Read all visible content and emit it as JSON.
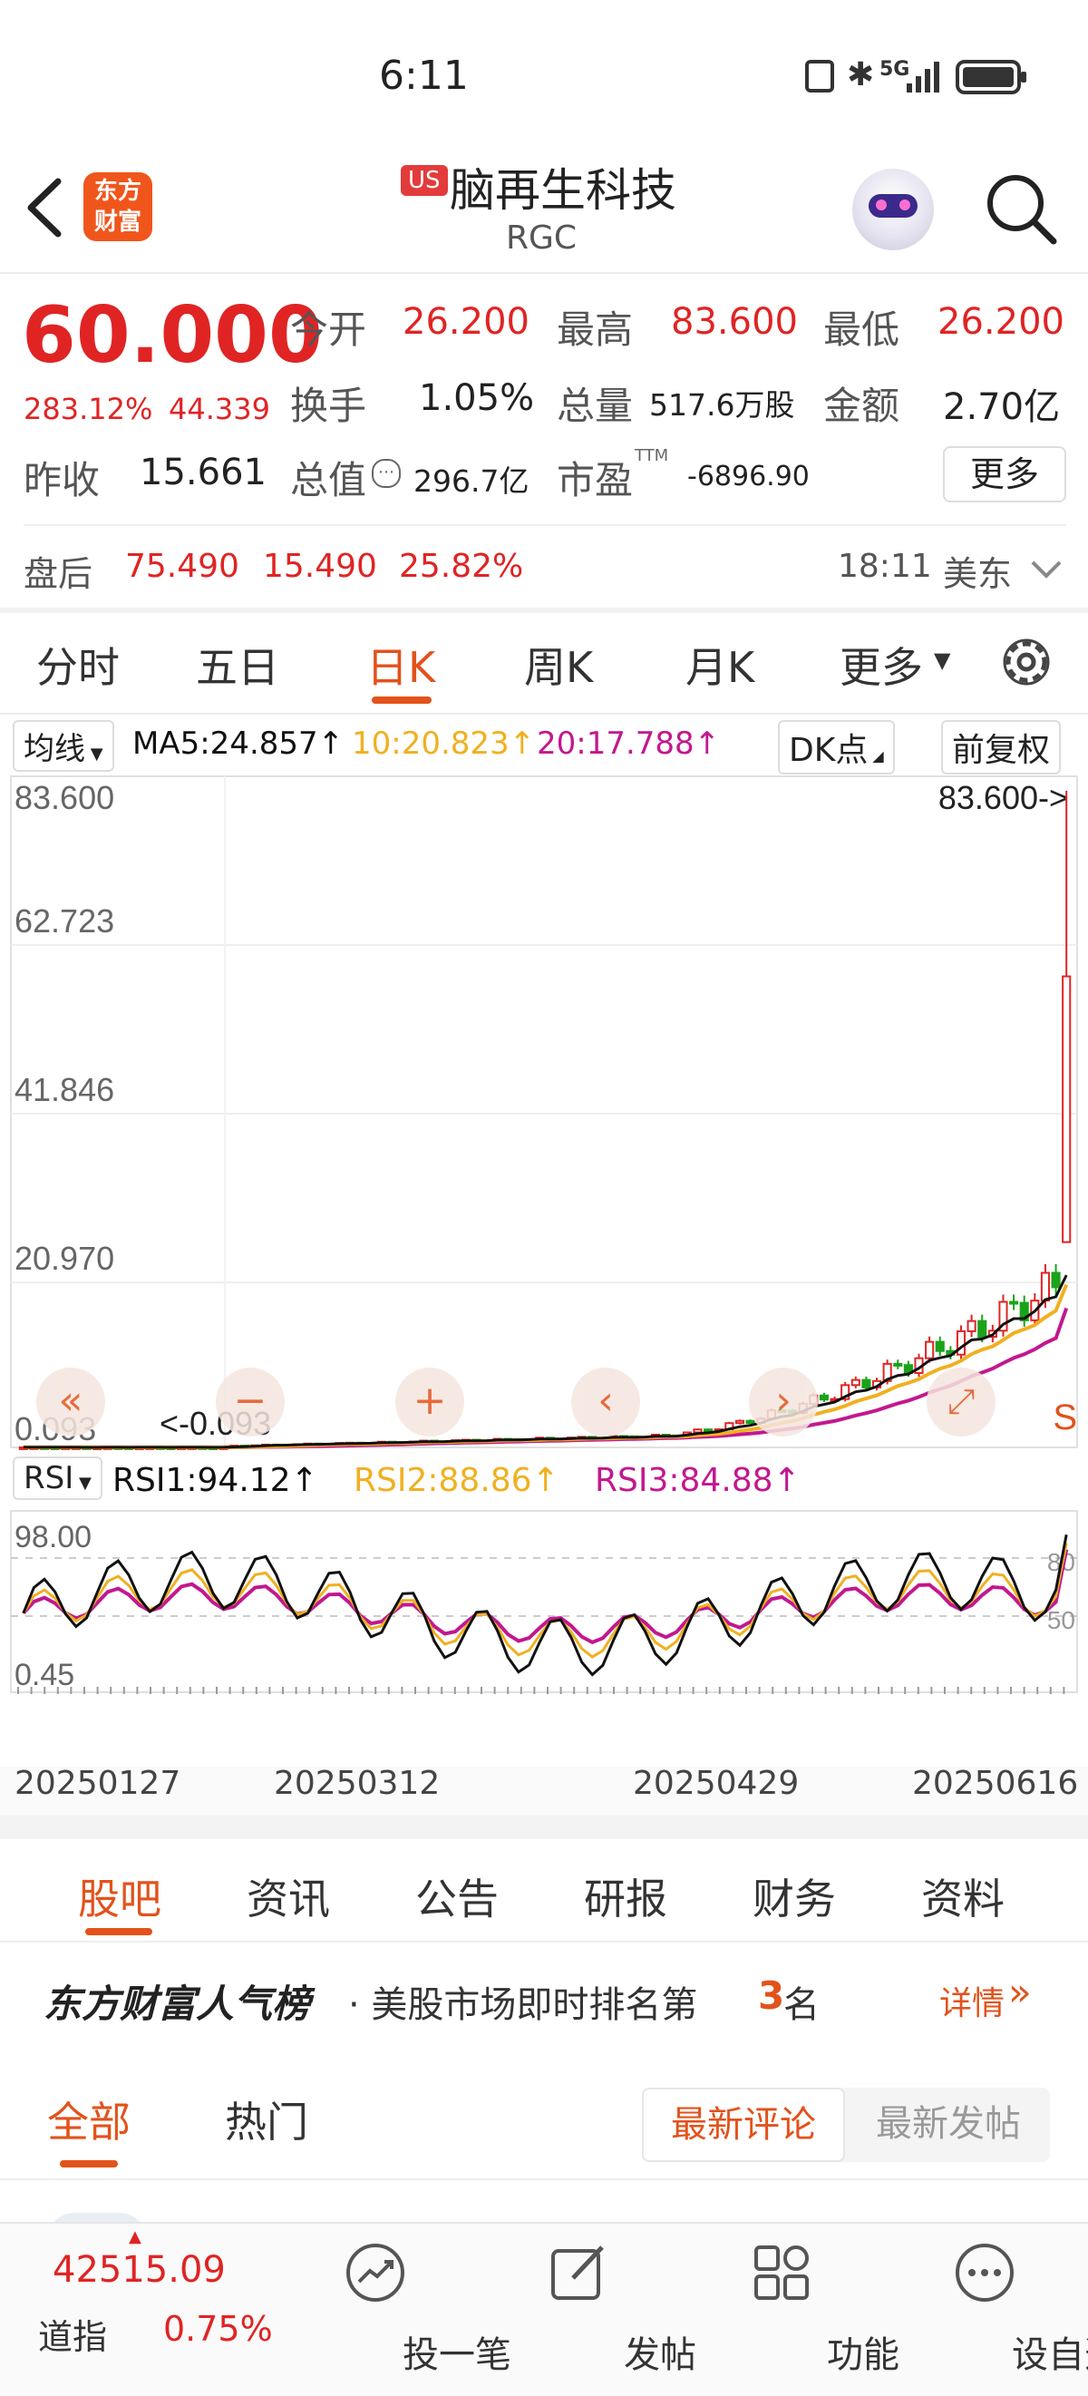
{
  "status_bar": {
    "time": "6:11",
    "signal": "5G"
  },
  "header": {
    "market_badge": "US",
    "name": "脑再生科技",
    "ticker": "RGC"
  },
  "quote": {
    "price": "60.000",
    "change_pct": "283.12%",
    "change": "44.339",
    "open_label": "今开",
    "open": "26.200",
    "high_label": "最高",
    "high": "83.600",
    "low_label": "最低",
    "low": "26.200",
    "turnover_label": "换手",
    "turnover": "1.05%",
    "volume_label": "总量",
    "volume": "517.6万股",
    "amount_label": "金额",
    "amount": "2.70亿",
    "prev_close_label": "昨收",
    "prev_close": "15.661",
    "mktcap_label": "总值",
    "mktcap": "296.7亿",
    "pe_label": "市盈",
    "pe_sup": "TTM",
    "pe": "-6896.90",
    "more_label": "更多"
  },
  "after_hours": {
    "label": "盘后",
    "price": "75.490",
    "change": "15.490",
    "pct": "25.82%",
    "time": "18:11",
    "tz": "美东"
  },
  "chart_tabs": [
    "分时",
    "五日",
    "日K",
    "周K",
    "月K",
    "更多"
  ],
  "ma_bar": {
    "selector": "均线",
    "ma5": "MA5:24.857↑",
    "ma10": "10:20.823↑",
    "ma20": "20:17.788↑",
    "dk": "DK点",
    "adjust": "前复权"
  },
  "kline": {
    "y_labels": [
      "83.600",
      "62.723",
      "41.846",
      "20.970",
      "0.093"
    ],
    "max_marker": "83.600->",
    "min_marker": "<-0.093",
    "s_mark": "S"
  },
  "rsi_bar": {
    "selector": "RSI",
    "rsi1": "RSI1:94.12↑",
    "rsi2": "RSI2:88.86↑",
    "rsi3": "RSI3:84.88↑"
  },
  "rsi": {
    "y_top": "98.00",
    "y_bottom": "0.45",
    "ref80": "80",
    "ref50": "50"
  },
  "dates": [
    "20250127",
    "20250312",
    "20250429",
    "20250616"
  ],
  "colors": {
    "up": "#e02424",
    "down": "#1aa31a",
    "ma5": "#111111",
    "ma10": "#f0b020",
    "ma20": "#c2188f",
    "accent": "#e2521b"
  },
  "chart_data": {
    "type": "line",
    "title": "",
    "x": [
      "20250127",
      "20250312",
      "20250429",
      "20250616"
    ],
    "ylim": [
      0.093,
      83.6
    ],
    "series": [
      {
        "name": "MA5",
        "values": [
          0.1,
          0.5,
          1.2,
          22.0
        ]
      },
      {
        "name": "10",
        "values": [
          0.1,
          0.4,
          1.0,
          20.8
        ]
      },
      {
        "name": "20",
        "values": [
          0.1,
          0.3,
          0.8,
          17.8
        ]
      }
    ],
    "last_close": 60.0,
    "last_high": 83.6,
    "last_low": 26.2
  },
  "section_tabs": [
    "股吧",
    "资讯",
    "公告",
    "研报",
    "财务",
    "资料"
  ],
  "ranking": {
    "brand": "东方财富人气榜",
    "text_prefix": "· 美股市场即时排名第",
    "rank": "3",
    "text_suffix": "名",
    "detail": "详情"
  },
  "feed_tabs": {
    "all": "全部",
    "hot": "热门",
    "latest_comment": "最新评论",
    "latest_post": "最新发帖"
  },
  "bottom": {
    "index_value": "42515.09",
    "index_name": "道指",
    "index_change": "0.75%",
    "nav": [
      "投一笔",
      "发帖",
      "功能",
      "设自选"
    ]
  }
}
